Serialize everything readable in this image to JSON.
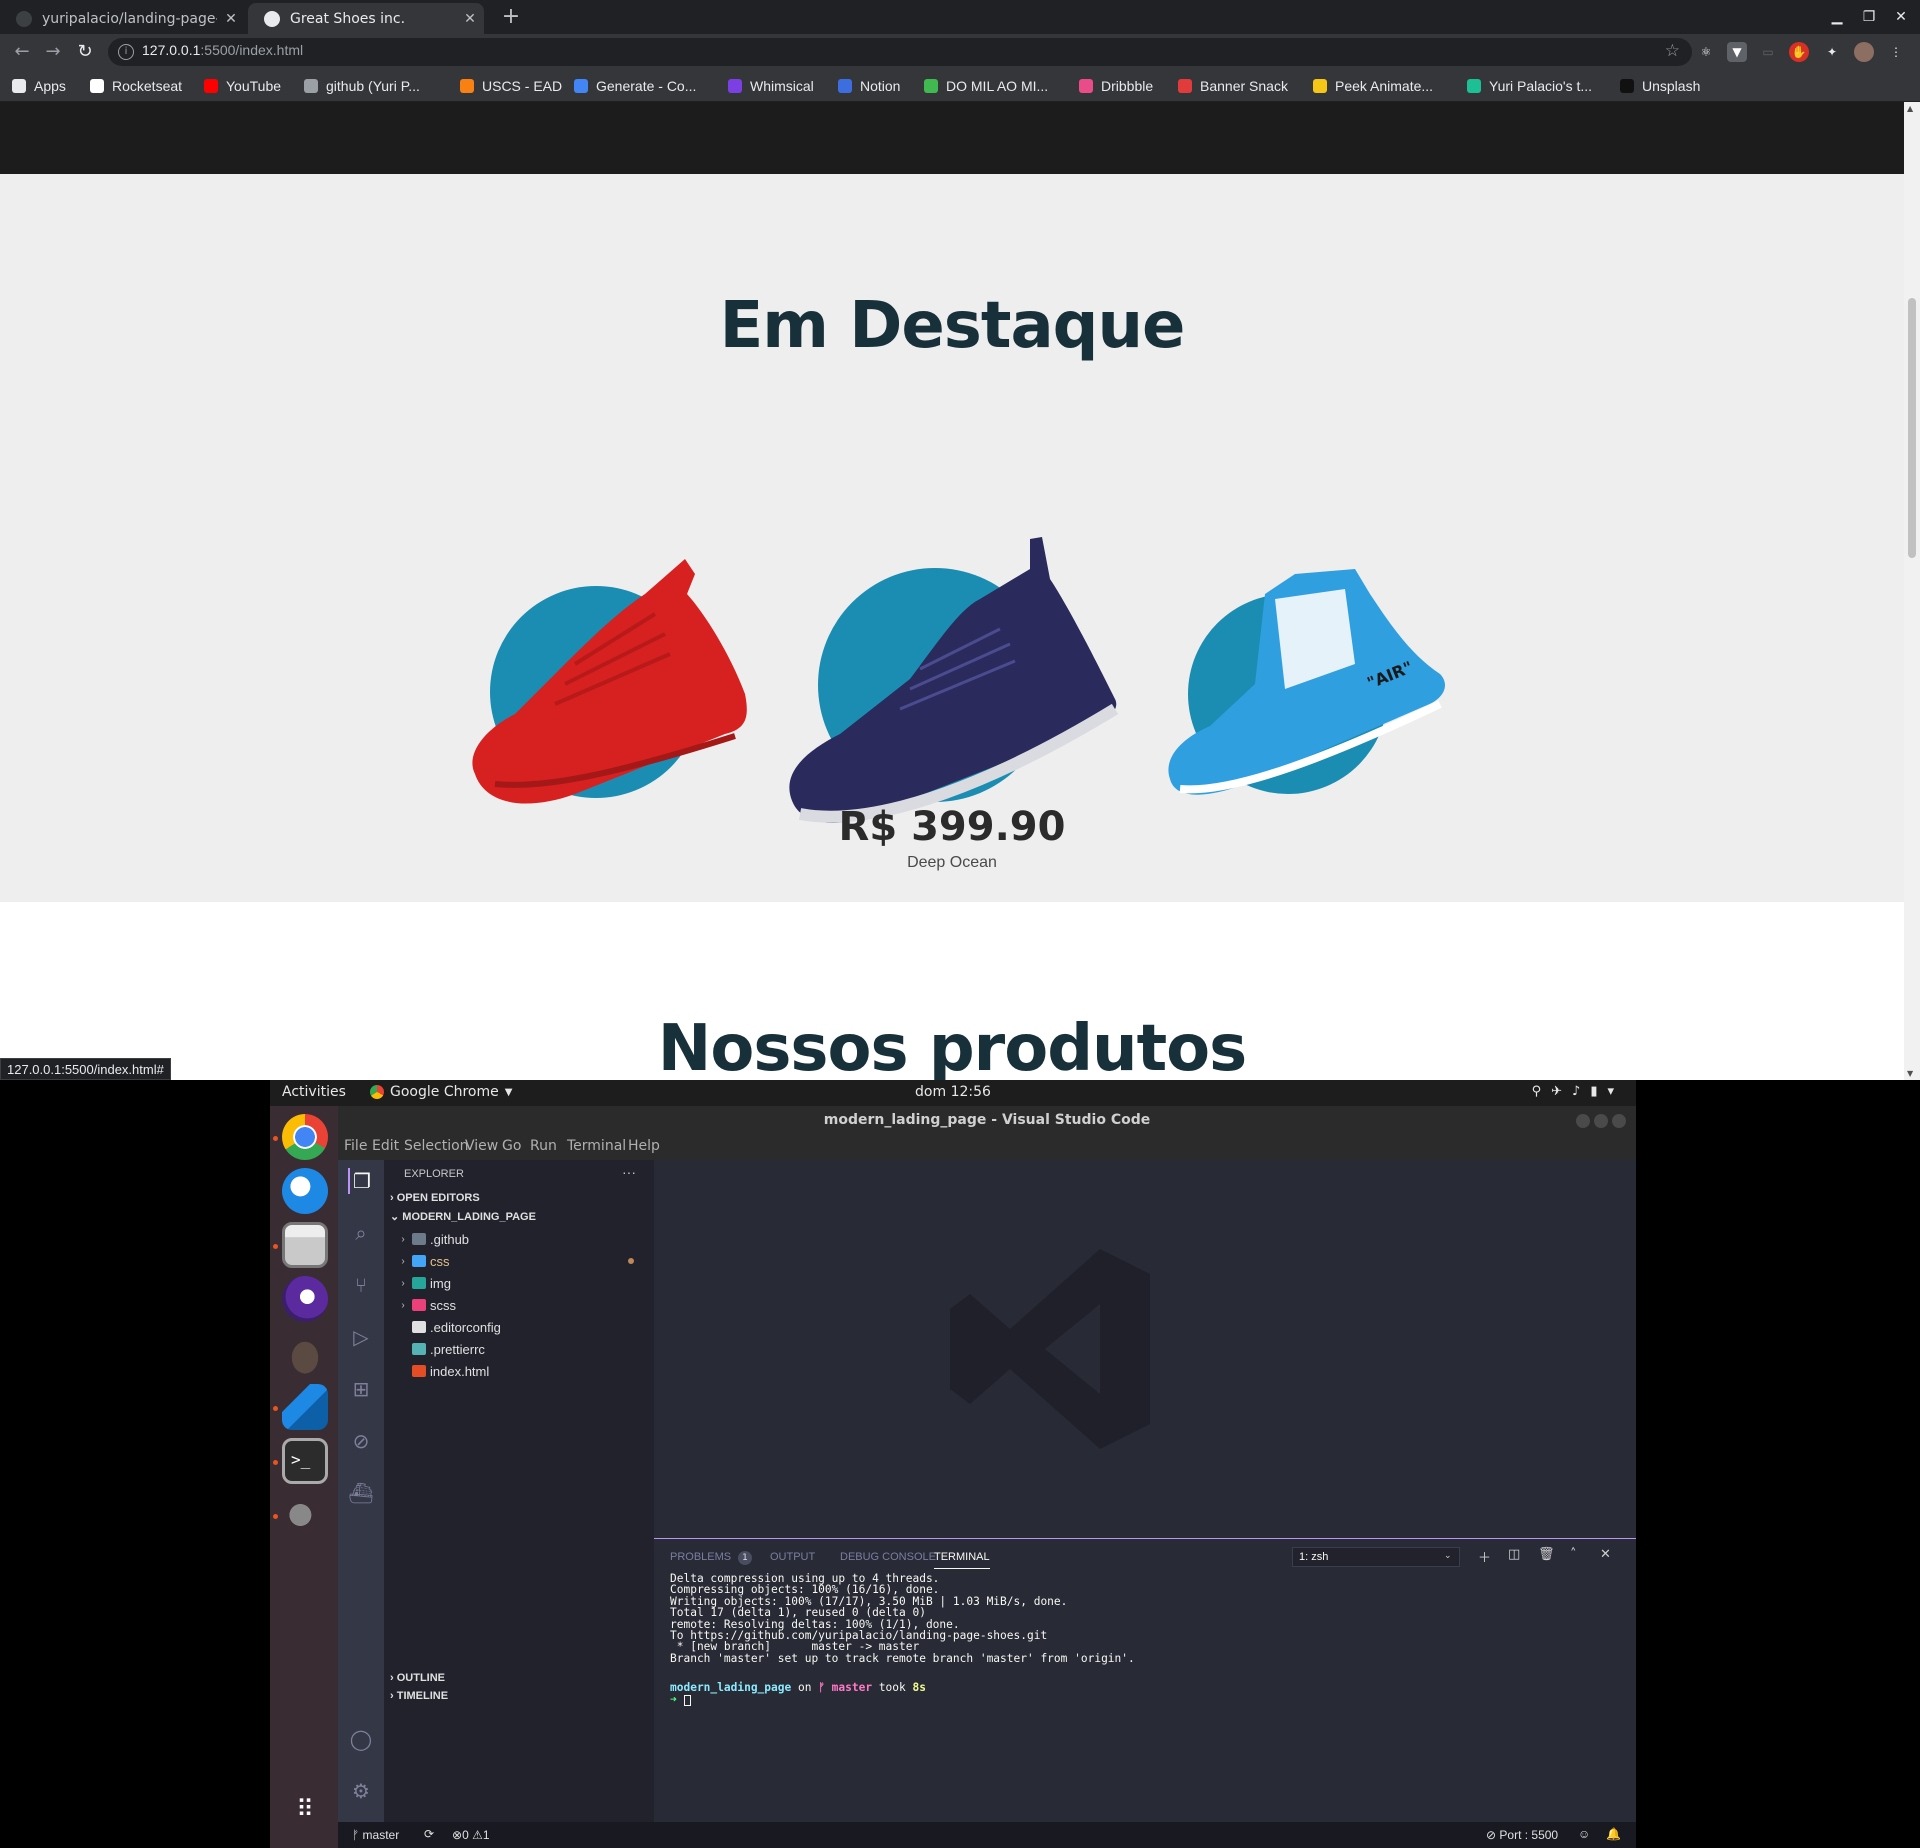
{
  "browser": {
    "tabs": [
      {
        "title": "yuripalacio/landing-page-",
        "active": false
      },
      {
        "title": "Great Shoes inc.",
        "active": true
      }
    ],
    "url_host": "127.0.0.1",
    "url_rest": ":5500/index.html",
    "bookmarks": [
      {
        "label": "Apps",
        "icon": "apps-grid-icon",
        "color": "#e8eaed"
      },
      {
        "label": "Rocketseat",
        "icon": "rocket-icon",
        "color": "#ffffff"
      },
      {
        "label": "YouTube",
        "icon": "youtube-icon",
        "color": "#ff0000"
      },
      {
        "label": "github (Yuri P...",
        "icon": "github-icon",
        "color": "#9aa0a6"
      },
      {
        "label": "USCS - EAD",
        "icon": "moodle-icon",
        "color": "#f98012"
      },
      {
        "label": "Generate - Co...",
        "icon": "generate-icon",
        "color": "#4285f4"
      },
      {
        "label": "Whimsical",
        "icon": "whimsical-icon",
        "color": "#7b3fe4"
      },
      {
        "label": "Notion",
        "icon": "notion-icon",
        "color": "#3d6ee0"
      },
      {
        "label": "DO MIL AO MI...",
        "icon": "dmam-icon",
        "color": "#3fb950"
      },
      {
        "label": "Dribbble",
        "icon": "dribbble-icon",
        "color": "#ea4c89"
      },
      {
        "label": "Banner Snack",
        "icon": "bannersnack-icon",
        "color": "#e23b3b"
      },
      {
        "label": "Peek Animate...",
        "icon": "peek-icon",
        "color": "#f5c518"
      },
      {
        "label": "Yuri Palacio's t...",
        "icon": "trello-icon",
        "color": "#1dbf94"
      },
      {
        "label": "Unsplash",
        "icon": "unsplash-icon",
        "color": "#111111"
      }
    ],
    "status_url": "127.0.0.1:5500/index.html#"
  },
  "page": {
    "featured_title": "Em Destaque",
    "price": "R$ 399.90",
    "shoe_name": "Deep Ocean",
    "products_title": "Nossos produtos",
    "colors": {
      "accent_circle": "#1b8db3",
      "title": "#17303a",
      "bg": "#eeeeee"
    }
  },
  "ubuntu": {
    "activities": "Activities",
    "app_name": "Google Chrome",
    "clock": "dom 12:56"
  },
  "vscode": {
    "title": "modern_lading_page - Visual Studio Code",
    "menu": [
      "File",
      "Edit",
      "Selection",
      "View",
      "Go",
      "Run",
      "Terminal",
      "Help"
    ],
    "explorer_label": "EXPLORER",
    "open_editors": "OPEN EDITORS",
    "project": "MODERN_LADING_PAGE",
    "files": [
      {
        "name": ".github",
        "folder": true,
        "color": "#6c7a89"
      },
      {
        "name": "css",
        "folder": true,
        "color": "#42a5f5",
        "modified": true
      },
      {
        "name": "img",
        "folder": true,
        "color": "#26a69a"
      },
      {
        "name": "scss",
        "folder": true,
        "color": "#ec407a"
      },
      {
        "name": ".editorconfig",
        "folder": false,
        "color": "#e0e0e0"
      },
      {
        "name": ".prettierrc",
        "folder": false,
        "color": "#56b3b4"
      },
      {
        "name": "index.html",
        "folder": false,
        "color": "#e44d26"
      }
    ],
    "outline": "OUTLINE",
    "timeline": "TIMELINE",
    "panel_tabs": {
      "problems": "PROBLEMS",
      "problems_count": "1",
      "output": "OUTPUT",
      "debug": "DEBUG CONSOLE",
      "terminal": "TERMINAL"
    },
    "terminal_select": "1: zsh",
    "terminal_lines": "Delta compression using up to 4 threads.\nCompressing objects: 100% (16/16), done.\nWriting objects: 100% (17/17), 3.50 MiB | 1.03 MiB/s, done.\nTotal 17 (delta 1), reused 0 (delta 0)\nremote: Resolving deltas: 100% (1/1), done.\nTo https://github.com/yuripalacio/landing-page-shoes.git\n * [new branch]      master -> master\nBranch 'master' set up to track remote branch 'master' from 'origin'.",
    "prompt_dir": "modern_lading_page",
    "prompt_on": " on ",
    "prompt_branch": "master",
    "prompt_took": " took ",
    "prompt_time": "8s",
    "prompt_arrow": "➜",
    "status": {
      "branch": "master",
      "errors": "0",
      "warnings": "1",
      "port": "Port : 5500"
    }
  }
}
